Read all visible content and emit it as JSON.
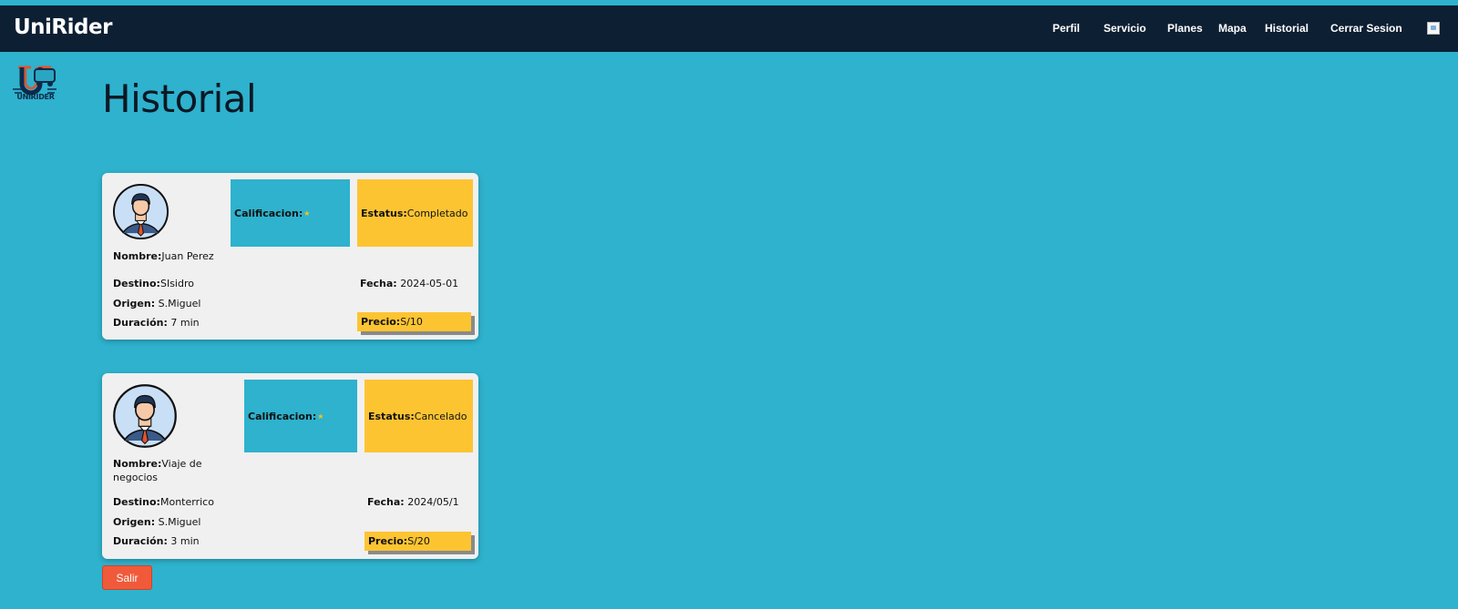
{
  "app": {
    "brand": "UniRider",
    "logo_caption": "UNIRIDER"
  },
  "nav": {
    "items": [
      {
        "label": "Perfil"
      },
      {
        "label": "Servicio"
      },
      {
        "label": "Planes"
      },
      {
        "label": "Mapa"
      },
      {
        "label": "Historial"
      },
      {
        "label": "Cerrar Sesion"
      }
    ]
  },
  "page": {
    "title": "Historial"
  },
  "trips": [
    {
      "calificacion_label": "Calificacion:",
      "estatus_label": "Estatus:",
      "estatus": "Completado",
      "nombre_label": "Nombre:",
      "nombre": "Juan Perez",
      "destino_label": "Destino:",
      "destino": "SIsidro",
      "origen_label": "Origen:",
      "origen": "S.Miguel",
      "duracion_label": "Duración:",
      "duracion": "7 min",
      "fecha_label": "Fecha:",
      "fecha": "2024-05-01",
      "precio_label": "Precio:",
      "precio": "S/10"
    },
    {
      "calificacion_label": "Calificacion:",
      "estatus_label": "Estatus:",
      "estatus": "Cancelado",
      "nombre_label": "Nombre:",
      "nombre": "Viaje de negocios",
      "destino_label": "Destino:",
      "destino": "Monterrico",
      "origen_label": "Origen:",
      "origen": "S.Miguel",
      "duracion_label": "Duración:",
      "duracion": "3 min",
      "fecha_label": "Fecha:",
      "fecha": "2024/05/1",
      "precio_label": "Precio:",
      "precio": "S/20"
    }
  ],
  "actions": {
    "exit_label": "Salir"
  },
  "colors": {
    "background": "#2eb2cd",
    "navbar": "#0d1f33",
    "card": "#f0f0f0",
    "yellow": "#fdc432",
    "exit_button": "#f05a3a"
  }
}
